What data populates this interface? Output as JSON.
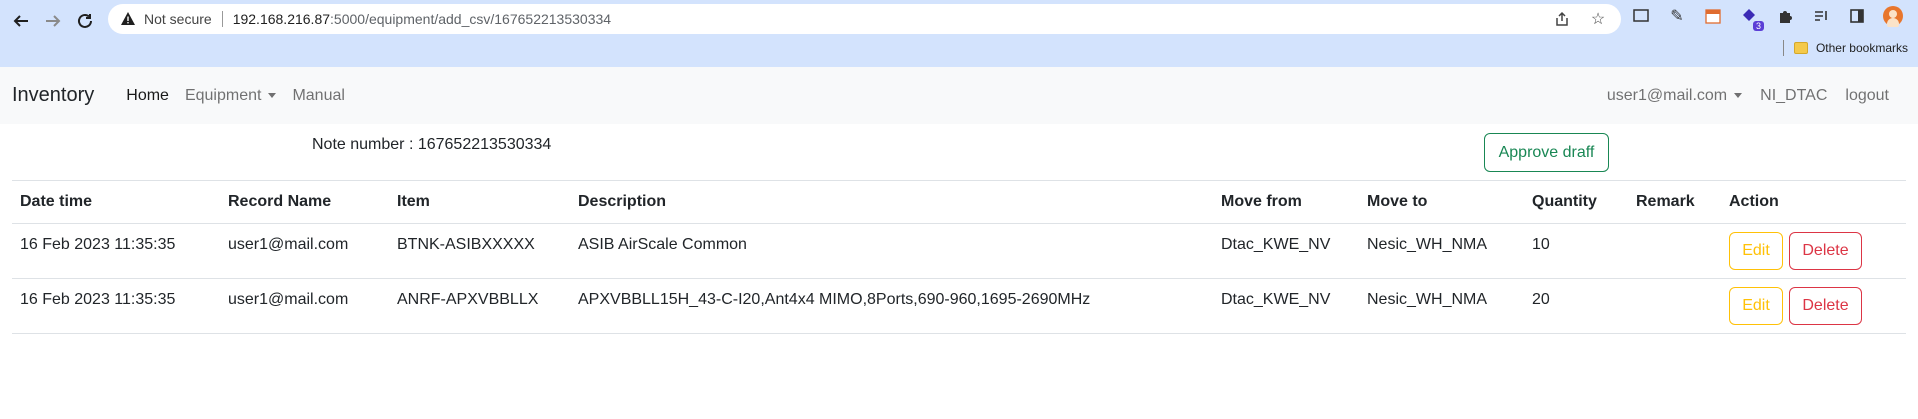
{
  "browser": {
    "security_label": "Not secure",
    "url_host": "192.168.216.87",
    "url_path": ":5000/equipment/add_csv/167652213530334",
    "bookmarks_label": "Other bookmarks",
    "extension_badge": "3"
  },
  "navbar": {
    "brand": "Inventory",
    "links": [
      {
        "label": "Home"
      },
      {
        "label": "Equipment"
      },
      {
        "label": "Manual"
      }
    ],
    "user": "user1@mail.com",
    "org": "NI_DTAC",
    "logout": "logout"
  },
  "page": {
    "note_label": "Note number : 167652213530334",
    "approve_button": "Approve draff"
  },
  "table": {
    "headers": [
      "Date time",
      "Record Name",
      "Item",
      "Description",
      "Move from",
      "Move to",
      "Quantity",
      "Remark",
      "Action"
    ],
    "rows": [
      {
        "datetime": "16 Feb 2023 11:35:35",
        "record_name": "user1@mail.com",
        "item": "BTNK-ASIBXXXXX",
        "description": "ASIB AirScale Common",
        "move_from": "Dtac_KWE_NV",
        "move_to": "Nesic_WH_NMA",
        "quantity": "10",
        "remark": "",
        "edit": "Edit",
        "delete": "Delete"
      },
      {
        "datetime": "16 Feb 2023 11:35:35",
        "record_name": "user1@mail.com",
        "item": "ANRF-APXVBBLLX",
        "description": "APXVBBLL15H_43-C-I20,Ant4x4 MIMO,8Ports,690-960,1695-2690MHz",
        "move_from": "Dtac_KWE_NV",
        "move_to": "Nesic_WH_NMA",
        "quantity": "20",
        "remark": "",
        "edit": "Edit",
        "delete": "Delete"
      }
    ]
  },
  "colors": {
    "approve": "#198754",
    "edit": "#ffc107",
    "delete": "#dc3545",
    "chrome_bg": "#d3e3fd"
  }
}
